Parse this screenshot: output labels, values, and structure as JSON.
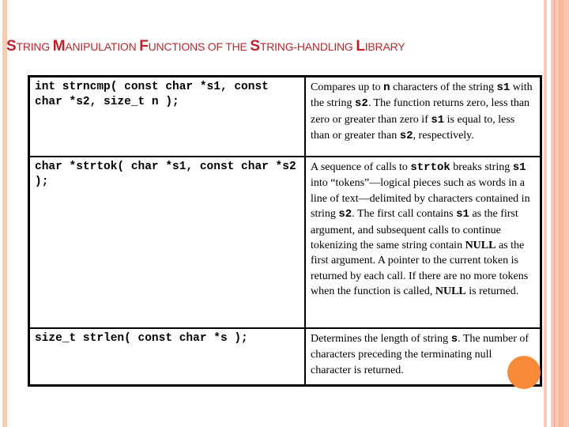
{
  "slide": {
    "title_parts": [
      {
        "cap": "S",
        "rest": "TRING "
      },
      {
        "cap": "M",
        "rest": "ANIPULATION "
      },
      {
        "cap": "F",
        "rest": "UNCTIONS OF THE "
      },
      {
        "cap": "S",
        "rest": "TRING-HANDLING "
      },
      {
        "cap": "L",
        "rest": "IBRARY"
      }
    ],
    "colors": {
      "accent_title": "#c0202a",
      "stripe": "#f9c9b6",
      "dot": "#f98a3a"
    }
  },
  "table": {
    "rows": [
      {
        "prototype": "int strncmp( const char *s1, const char *s2, size_t n );",
        "description": [
          {
            "t": " Compares up to "
          },
          {
            "c": "n"
          },
          {
            "t": " characters of the string "
          },
          {
            "c": "s1"
          },
          {
            "t": " with the string "
          },
          {
            "c": "s2"
          },
          {
            "t": ". The function returns zero, less than zero or greater than zero if "
          },
          {
            "c": "s1"
          },
          {
            "t": " is equal to, less than or greater than "
          },
          {
            "c": "s2"
          },
          {
            "t": ", respectively."
          }
        ]
      },
      {
        "prototype": "char *strtok( char *s1, const char *s2 );",
        "description": [
          {
            "t": " A sequence of calls to "
          },
          {
            "c": "strtok"
          },
          {
            "t": " breaks string "
          },
          {
            "c": "s1"
          },
          {
            "t": " into “tokens”—logical pieces such as words in a line of text—delimited by characters contained in string "
          },
          {
            "c": "s2"
          },
          {
            "t": ". The first call contains "
          },
          {
            "c": "s1"
          },
          {
            "t": " as the first argument, and subsequent calls to continue tokenizing the same string contain "
          },
          {
            "b": "NULL"
          },
          {
            "t": " as the first argument. A pointer to the current token is returned by each call. If there are no more tokens when the function is called, "
          },
          {
            "b": "NULL"
          },
          {
            "t": " is returned."
          }
        ]
      },
      {
        "prototype": "size_t strlen( const char *s );",
        "description": [
          {
            "t": " Determines the length of string "
          },
          {
            "c": "s"
          },
          {
            "t": ". The number of characters preceding the terminating null character is returned."
          }
        ]
      }
    ]
  }
}
